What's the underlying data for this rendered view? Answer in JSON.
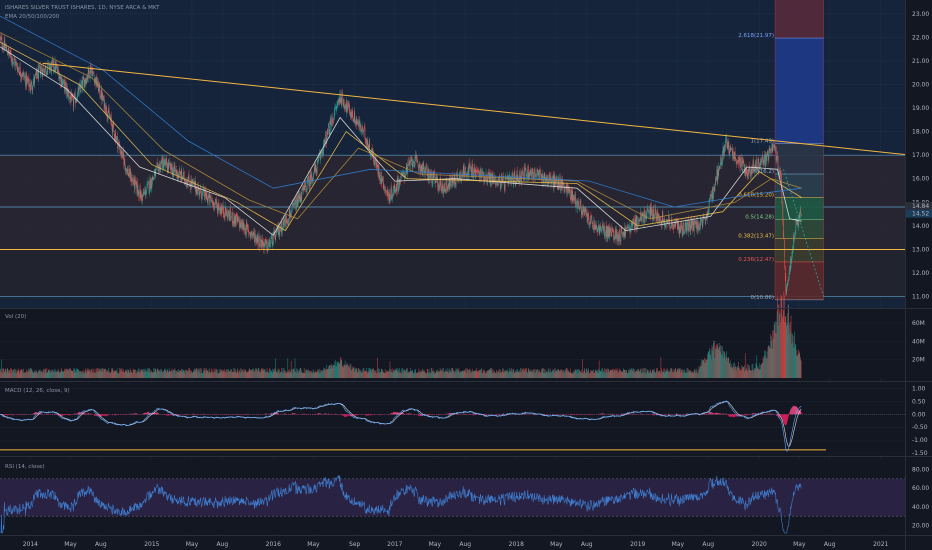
{
  "header": {
    "title": "ISHARES SILVER TRUST ISHARES, 1D, NYSE ARCA & MKT",
    "indicator": "EMA 20/50/100/200"
  },
  "panes": {
    "vol_label": "Vol (20)",
    "macd_label": "MACD (12, 26, close, 9)",
    "rsi_label": "RSI (14, close)"
  },
  "colors": {
    "background": "#131722",
    "candle_up": "#26a69a",
    "candle_down": "#ef5350",
    "ema20": "#e8e6e3",
    "ema50": "#f0c14b",
    "ema100": "#b58d3d",
    "ema200": "#2f7fd6",
    "trendline": "#f5b743",
    "support": "#f5b743",
    "macd": "#5da8ff",
    "signal": "#d9d9d9",
    "hist_neg": "#e91e63",
    "rsi": "#3f7fd1",
    "rsi_band": "#3a2a5a"
  },
  "chart_data": [
    {
      "type": "candlestick",
      "x_ticks": [
        "2014",
        "May",
        "Aug",
        "2015",
        "May",
        "Aug",
        "2016",
        "May",
        "Sep",
        "2017",
        "May",
        "Aug",
        "2018",
        "May",
        "Aug",
        "2019",
        "May",
        "Aug",
        "2020",
        "May",
        "Aug",
        "2021"
      ],
      "y_ticks": [
        11.0,
        12.0,
        13.0,
        14.0,
        15.0,
        16.0,
        17.0,
        18.0,
        19.0,
        20.0,
        21.0,
        22.0,
        23.0
      ],
      "ylim": [
        10.6,
        23.5
      ],
      "price_labels": {
        "current": "14.84",
        "secondary": "14.52"
      },
      "key_points": [
        {
          "x": 2013.75,
          "y": 21.9
        },
        {
          "x": 2014.0,
          "y": 19.9
        },
        {
          "x": 2014.08,
          "y": 20.6
        },
        {
          "x": 2014.2,
          "y": 20.8
        },
        {
          "x": 2014.35,
          "y": 19.2
        },
        {
          "x": 2014.5,
          "y": 20.7
        },
        {
          "x": 2014.65,
          "y": 18.6
        },
        {
          "x": 2014.8,
          "y": 16.3
        },
        {
          "x": 2014.92,
          "y": 15.2
        },
        {
          "x": 2015.08,
          "y": 16.7
        },
        {
          "x": 2015.3,
          "y": 15.9
        },
        {
          "x": 2015.5,
          "y": 15.0
        },
        {
          "x": 2015.7,
          "y": 14.2
        },
        {
          "x": 2015.95,
          "y": 13.1
        },
        {
          "x": 2016.15,
          "y": 14.6
        },
        {
          "x": 2016.35,
          "y": 16.4
        },
        {
          "x": 2016.55,
          "y": 19.5
        },
        {
          "x": 2016.75,
          "y": 17.9
        },
        {
          "x": 2016.95,
          "y": 15.2
        },
        {
          "x": 2017.15,
          "y": 16.8
        },
        {
          "x": 2017.4,
          "y": 15.6
        },
        {
          "x": 2017.6,
          "y": 16.4
        },
        {
          "x": 2017.9,
          "y": 15.8
        },
        {
          "x": 2018.1,
          "y": 16.3
        },
        {
          "x": 2018.4,
          "y": 15.7
        },
        {
          "x": 2018.65,
          "y": 13.9
        },
        {
          "x": 2018.85,
          "y": 13.6
        },
        {
          "x": 2019.1,
          "y": 14.6
        },
        {
          "x": 2019.35,
          "y": 13.9
        },
        {
          "x": 2019.55,
          "y": 14.1
        },
        {
          "x": 2019.72,
          "y": 17.5
        },
        {
          "x": 2019.9,
          "y": 16.3
        },
        {
          "x": 2020.05,
          "y": 16.8
        },
        {
          "x": 2020.12,
          "y": 17.4
        },
        {
          "x": 2020.18,
          "y": 16.0
        },
        {
          "x": 2020.22,
          "y": 11.2
        },
        {
          "x": 2020.3,
          "y": 14.0
        },
        {
          "x": 2020.35,
          "y": 14.6
        }
      ],
      "ema_approx": {
        "ema20": [
          [
            2013.75,
            21.6
          ],
          [
            2014.3,
            19.8
          ],
          [
            2014.9,
            16.5
          ],
          [
            2015.6,
            15.2
          ],
          [
            2016.0,
            13.6
          ],
          [
            2016.55,
            18.6
          ],
          [
            2017.0,
            15.9
          ],
          [
            2017.5,
            16.0
          ],
          [
            2018.5,
            15.6
          ],
          [
            2018.9,
            13.8
          ],
          [
            2019.6,
            14.4
          ],
          [
            2019.9,
            16.5
          ],
          [
            2020.15,
            16.4
          ],
          [
            2020.25,
            14.3
          ],
          [
            2020.35,
            14.2
          ]
        ],
        "ema50": [
          [
            2013.75,
            21.8
          ],
          [
            2014.4,
            20.0
          ],
          [
            2015.0,
            16.6
          ],
          [
            2015.7,
            15.0
          ],
          [
            2016.1,
            13.8
          ],
          [
            2016.6,
            18.0
          ],
          [
            2017.1,
            16.0
          ],
          [
            2018.5,
            15.8
          ],
          [
            2019.0,
            14.0
          ],
          [
            2019.7,
            14.6
          ],
          [
            2020.0,
            16.3
          ],
          [
            2020.35,
            15.2
          ]
        ],
        "ema100": [
          [
            2013.75,
            22.2
          ],
          [
            2014.5,
            20.3
          ],
          [
            2015.1,
            17.2
          ],
          [
            2015.8,
            15.1
          ],
          [
            2016.2,
            14.3
          ],
          [
            2016.7,
            17.3
          ],
          [
            2017.2,
            16.2
          ],
          [
            2018.5,
            15.9
          ],
          [
            2019.1,
            14.3
          ],
          [
            2019.8,
            15.0
          ],
          [
            2020.1,
            16.0
          ],
          [
            2020.35,
            15.6
          ]
        ],
        "ema200": [
          [
            2013.75,
            22.9
          ],
          [
            2014.6,
            20.6
          ],
          [
            2015.3,
            17.6
          ],
          [
            2016.0,
            15.6
          ],
          [
            2016.8,
            16.4
          ],
          [
            2017.5,
            16.2
          ],
          [
            2018.6,
            15.9
          ],
          [
            2019.3,
            14.8
          ],
          [
            2019.9,
            15.3
          ],
          [
            2020.35,
            15.6
          ]
        ]
      },
      "trendline": [
        [
          2014.1,
          20.9
        ],
        [
          2020.7,
          17.3
        ]
      ],
      "support_level": 13.0,
      "horizontal_levels": [
        17.0,
        14.8,
        11.0
      ],
      "fibonacci": {
        "levels": [
          {
            "label": "1(17.49)",
            "value": 17.49
          },
          {
            "label": "0.786(16.2)",
            "value": 16.2
          },
          {
            "label": "0.618(15.20)",
            "value": 15.2
          },
          {
            "label": "0.5(14.28)",
            "value": 14.28
          },
          {
            "label": "0.382(13.47)",
            "value": 13.47
          },
          {
            "label": "0.236(12.47)",
            "value": 12.47
          },
          {
            "label": "0(10.86)",
            "value": 10.86
          }
        ],
        "extension_label": "2.618(21.97)",
        "extension_value": 21.97
      }
    },
    {
      "type": "bar",
      "name": "Vol (20)",
      "y_ticks": [
        "60M",
        "40M",
        "20M"
      ],
      "ylim": [
        0,
        72
      ],
      "peaks_x": [
        2016.55,
        2019.65,
        2020.15,
        2020.22
      ],
      "peaks_value": [
        22,
        42,
        58,
        70
      ]
    },
    {
      "type": "line",
      "name": "MACD (12, 26, close, 9)",
      "y_ticks": [
        "1.00",
        "0.50",
        "0.00",
        "-0.50",
        "-1.00",
        "-1.50"
      ],
      "ylim": [
        -1.5,
        1.1
      ],
      "trough": {
        "x": 2020.22,
        "value": -1.35
      }
    },
    {
      "type": "line",
      "name": "RSI (14, close)",
      "y_ticks": [
        "80.00",
        "60.00",
        "40.00",
        "20.00"
      ],
      "ylim": [
        12,
        88
      ],
      "band": [
        30,
        70
      ]
    }
  ]
}
